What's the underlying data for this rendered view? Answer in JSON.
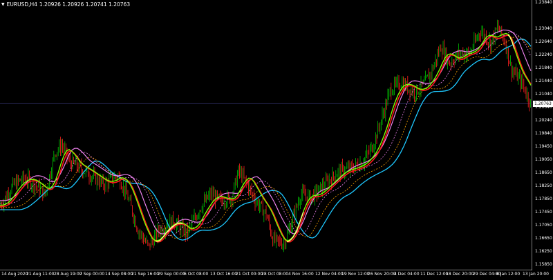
{
  "header": {
    "symbol": "EURUSD,H4",
    "ohlc": "1.20926 1.20926 1.20741 1.20763"
  },
  "price_axis": {
    "labels": [
      "1.23840",
      "1.23040",
      "1.22640",
      "1.22240",
      "1.21840",
      "1.21440",
      "1.21040",
      "1.20640",
      "1.20240",
      "1.19840",
      "1.19450",
      "1.19050",
      "1.18650",
      "1.18250",
      "1.17850",
      "1.17450",
      "1.17050",
      "1.16650",
      "1.16250",
      "1.15850"
    ],
    "current_price": "1.20763"
  },
  "time_axis": {
    "labels": [
      "14 Aug 2020",
      "21 Aug 11:00",
      "28 Aug 19:00",
      "7 Sep 00:00",
      "14 Sep 08:00",
      "21 Sep 16:00",
      "29 Sep 00:00",
      "6 Oct 08:00",
      "13 Oct 16:00",
      "21 Oct 00:00",
      "28 Oct 08:00",
      "4 Nov 16:00",
      "12 Nov 04:00",
      "19 Nov 12:00",
      "26 Nov 20:00",
      "4 Dec 04:00",
      "11 Dec 12:00",
      "18 Dec 20:00",
      "29 Dec 04:00",
      "6 Jan 12:00",
      "13 Jan 20:00"
    ]
  },
  "colors": {
    "background": "#000000",
    "bull_candle": "#00c000",
    "bear_candle": "#ff2020",
    "line_lime": "#7cfc00",
    "line_red": "#ff1a1a",
    "line_blue": "#1ec8ff",
    "line_violet": "#ee82ee",
    "line_yellow": "#ffff80",
    "line_orange": "#ffa500",
    "current_price_line": "#2a2a5a"
  }
}
